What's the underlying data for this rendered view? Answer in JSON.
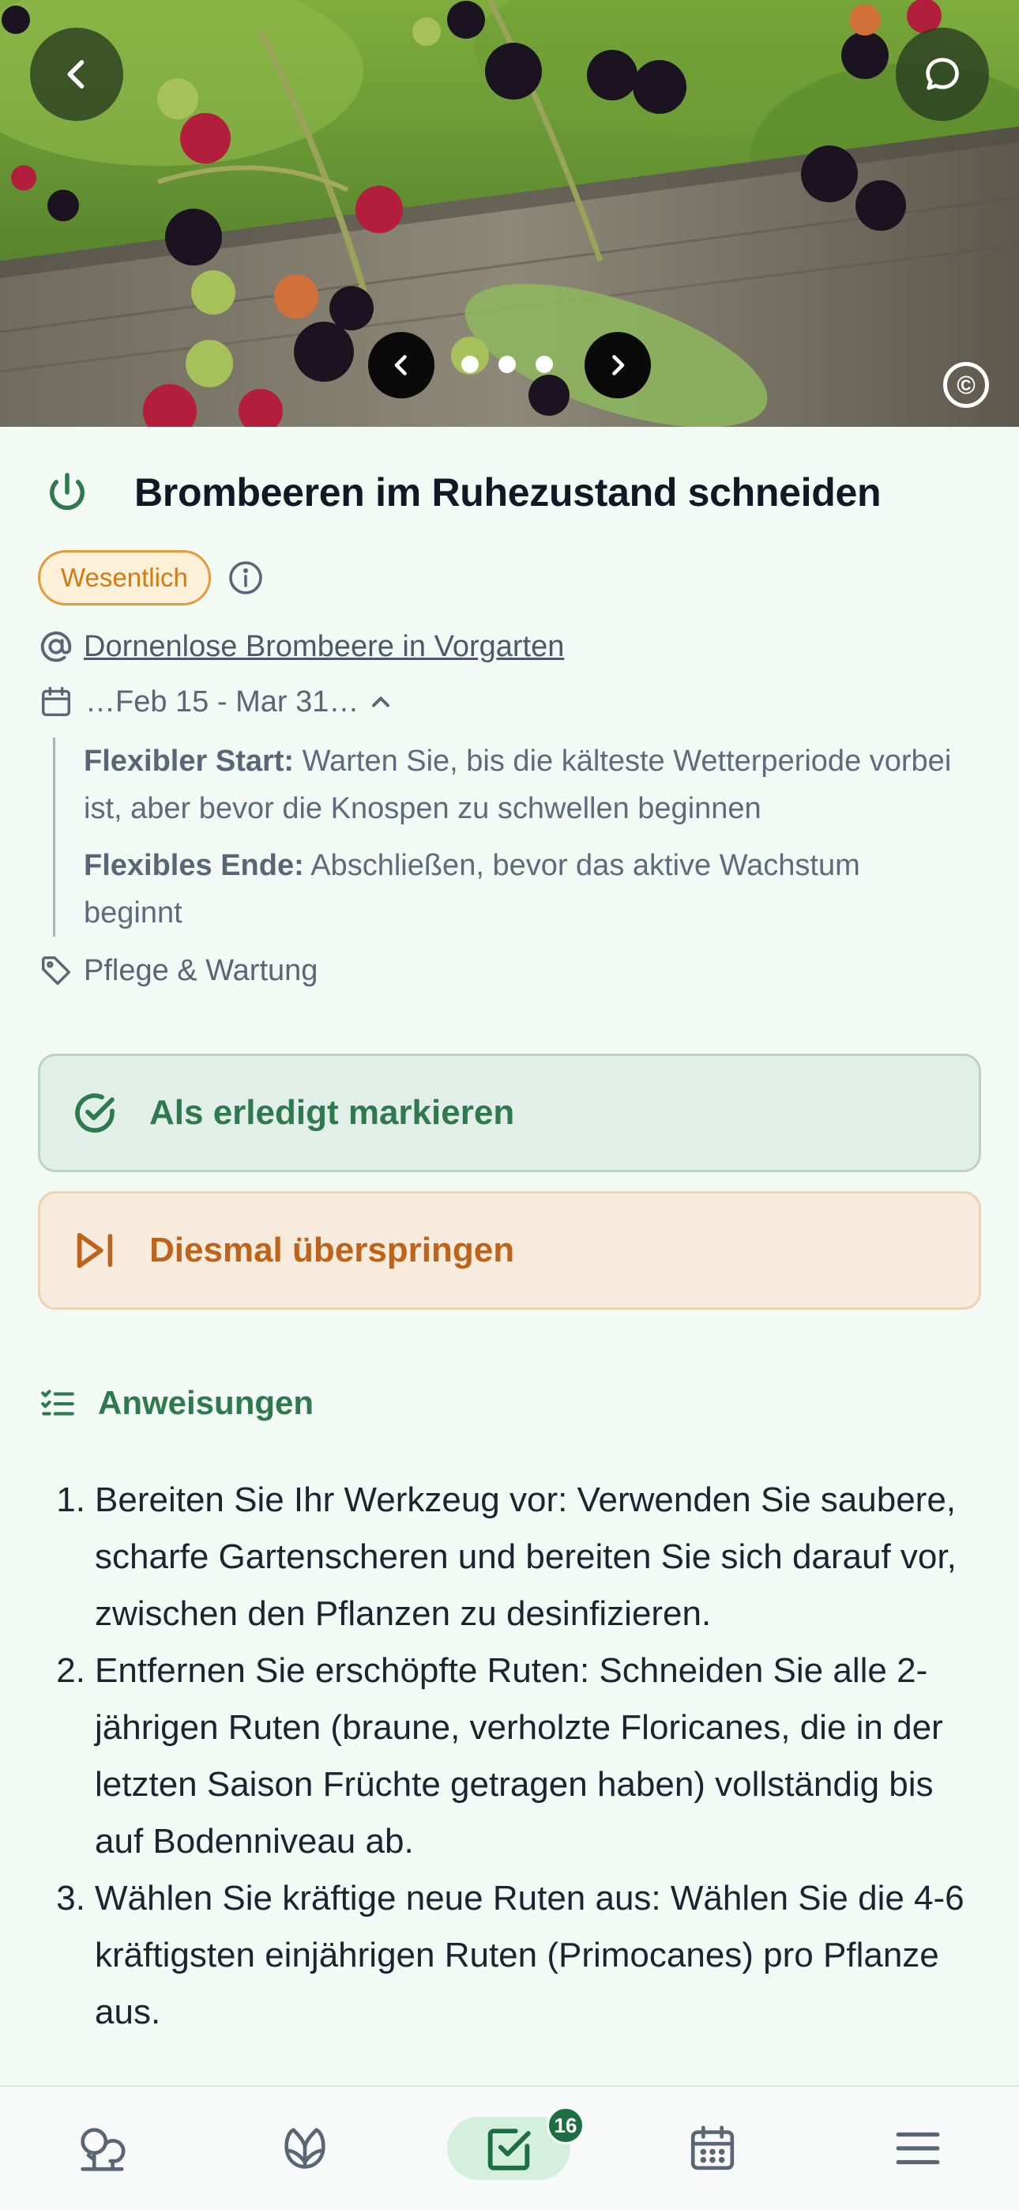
{
  "header": {
    "back_icon": "chevron-left-icon",
    "chat_icon": "chat-bubble-icon",
    "carousel": {
      "total_photos": 3,
      "active_index": 0
    },
    "copyright_symbol": "©"
  },
  "task": {
    "status_icon": "power-icon",
    "title": "Brombeeren im Ruhezustand schneiden",
    "badge": "Wesentlich",
    "plant_link": "Dornenlose Brombeere in Vorgarten",
    "date_range": "…Feb 15 - Mar 31…",
    "flex_start_label": "Flexibler Start:",
    "flex_start_text": " Warten Sie, bis die kälteste Wetterperiode vorbei ist, aber bevor die Knospen zu schwellen beginnen",
    "flex_end_label": "Flexibles Ende:",
    "flex_end_text": " Abschließen, bevor das aktive Wachstum beginnt",
    "category": "Pflege & Wartung"
  },
  "actions": {
    "done_label": "Als erledigt markieren",
    "skip_label": "Diesmal überspringen"
  },
  "instructions": {
    "heading": "Anweisungen",
    "steps": [
      {
        "num": "1.",
        "text": "Bereiten Sie Ihr Werkzeug vor: Verwenden Sie saubere, scharfe Gartenscheren und bereiten Sie sich darauf vor, zwischen den Pflanzen zu desinfizieren."
      },
      {
        "num": "2.",
        "text": "Entfernen Sie erschöpfte Ruten: Schneiden Sie alle 2-jährigen Ruten (braune, verholzte Floricanes, die in der letzten Saison Früchte getragen haben) vollständig bis auf Bodenniveau ab."
      },
      {
        "num": "3.",
        "text": "Wählen Sie kräftige neue Ruten aus: Wählen Sie die 4-6 kräftigsten einjährigen Ruten (Primocanes) pro Pflanze aus."
      }
    ]
  },
  "bottom_nav": {
    "items": [
      "garden-icon",
      "plants-icon",
      "tasks-icon",
      "calendar-icon",
      "menu-icon"
    ],
    "active": "tasks-icon",
    "tasks_badge": "16"
  },
  "colors": {
    "accent_green": "#2e7a4e",
    "skip_orange": "#c0631a",
    "badge_orange": "#d17b12",
    "background": "#f3faf6"
  }
}
